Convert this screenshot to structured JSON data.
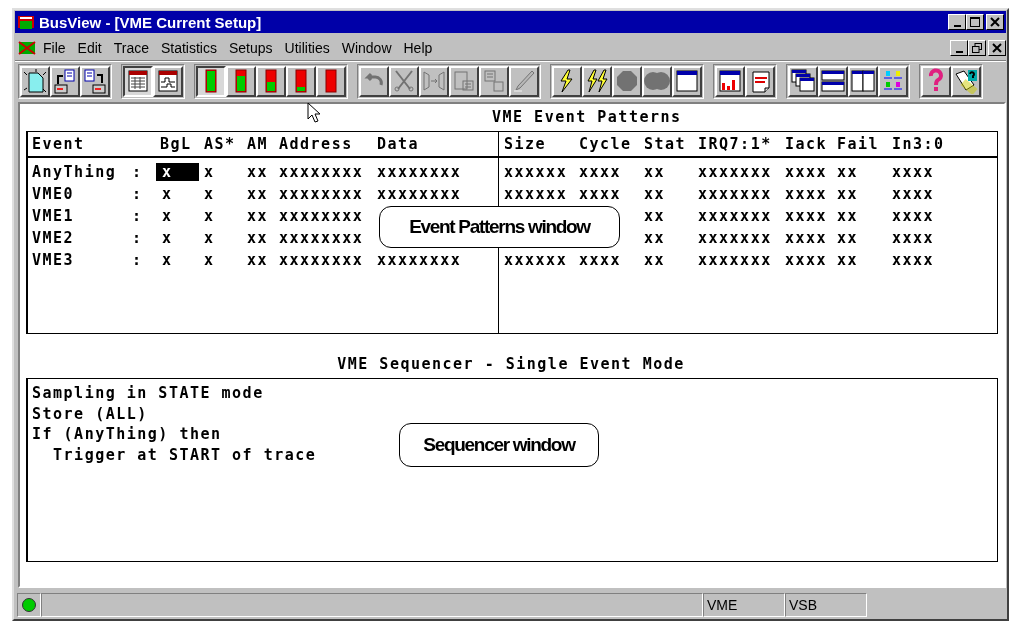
{
  "window": {
    "title": "BusView - [VME Current Setup]"
  },
  "menu": [
    "File",
    "Edit",
    "Trace",
    "Statistics",
    "Setups",
    "Utilities",
    "Window",
    "Help"
  ],
  "toolbar": [
    [
      {
        "kind": "new",
        "disabled": false,
        "pressed": false
      },
      {
        "kind": "open",
        "disabled": false,
        "pressed": false
      },
      {
        "kind": "save",
        "disabled": false,
        "pressed": false
      }
    ],
    [
      {
        "kind": "table",
        "disabled": false,
        "pressed": true
      },
      {
        "kind": "waveform",
        "disabled": false,
        "pressed": false
      }
    ],
    [
      {
        "kind": "all-green",
        "disabled": false,
        "pressed": true
      },
      {
        "kind": "mostly-green",
        "disabled": false,
        "pressed": false
      },
      {
        "kind": "half-green",
        "disabled": false,
        "pressed": false
      },
      {
        "kind": "mostly-red",
        "disabled": false,
        "pressed": false
      },
      {
        "kind": "all-red",
        "disabled": false,
        "pressed": false
      }
    ],
    [
      {
        "kind": "undo",
        "disabled": true,
        "pressed": false
      },
      {
        "kind": "cut",
        "disabled": true,
        "pressed": false
      },
      {
        "kind": "split",
        "disabled": true,
        "pressed": false
      },
      {
        "kind": "paste",
        "disabled": true,
        "pressed": false
      },
      {
        "kind": "paste-table",
        "disabled": true,
        "pressed": false
      },
      {
        "kind": "pen",
        "disabled": true,
        "pressed": false
      }
    ],
    [
      {
        "kind": "bolt",
        "disabled": false,
        "pressed": false
      },
      {
        "kind": "bolts",
        "disabled": false,
        "pressed": false
      },
      {
        "kind": "stop",
        "disabled": true,
        "pressed": false
      },
      {
        "kind": "stops",
        "disabled": true,
        "pressed": false
      },
      {
        "kind": "window",
        "disabled": false,
        "pressed": false
      }
    ],
    [
      {
        "kind": "chart",
        "disabled": false,
        "pressed": false
      },
      {
        "kind": "trap",
        "disabled": false,
        "pressed": false
      }
    ],
    [
      {
        "kind": "cascade",
        "disabled": false,
        "pressed": false
      },
      {
        "kind": "tile-h",
        "disabled": false,
        "pressed": false
      },
      {
        "kind": "tile-v",
        "disabled": false,
        "pressed": false
      },
      {
        "kind": "arrange",
        "disabled": false,
        "pressed": false
      }
    ],
    [
      {
        "kind": "help",
        "disabled": false,
        "pressed": false
      },
      {
        "kind": "context-help",
        "disabled": false,
        "pressed": false
      }
    ]
  ],
  "patterns": {
    "title": "VME Event Patterns",
    "left_columns": [
      "Event",
      "BgL",
      "AS*",
      "AM",
      "Address",
      "Data"
    ],
    "right_columns": [
      "Size",
      "Cycle",
      "Stat",
      "IRQ7:1*",
      "Iack",
      "Fail",
      "In3:0"
    ],
    "rows": [
      {
        "event": "AnyThing",
        "sep": ":",
        "cells": [
          {
            "t": "x",
            "selected": true
          },
          {
            "t": "x",
            "selected": false
          },
          {
            "t": "xx",
            "selected": false
          },
          {
            "t": "xxxxxxxx",
            "selected": false
          },
          {
            "t": "xxxxxxxx",
            "selected": false
          },
          {
            "t": "xxxxxx",
            "selected": false
          },
          {
            "t": "xxxx",
            "selected": false
          },
          {
            "t": "xx",
            "selected": false
          },
          {
            "t": "xxxxxxx",
            "selected": false
          },
          {
            "t": "xxxx",
            "selected": false
          },
          {
            "t": "xx",
            "selected": false
          },
          {
            "t": "xxxx",
            "selected": false
          }
        ]
      },
      {
        "event": "VME0",
        "sep": ":",
        "cells": [
          {
            "t": "x",
            "selected": false
          },
          {
            "t": "x",
            "selected": false
          },
          {
            "t": "xx",
            "selected": false
          },
          {
            "t": "xxxxxxxx",
            "selected": false
          },
          {
            "t": "xxxxxxxx",
            "selected": false
          },
          {
            "t": "xxxxxx",
            "selected": false
          },
          {
            "t": "xxxx",
            "selected": false
          },
          {
            "t": "xx",
            "selected": false
          },
          {
            "t": "xxxxxxx",
            "selected": false
          },
          {
            "t": "xxxx",
            "selected": false
          },
          {
            "t": "xx",
            "selected": false
          },
          {
            "t": "xxxx",
            "selected": false
          }
        ]
      },
      {
        "event": "VME1",
        "sep": ":",
        "cells": [
          {
            "t": "x",
            "selected": false
          },
          {
            "t": "x",
            "selected": false
          },
          {
            "t": "xx",
            "selected": false
          },
          {
            "t": "xxxxxxxx",
            "selected": false
          },
          null,
          null,
          null,
          {
            "t": "xx",
            "selected": false
          },
          {
            "t": "xxxxxxx",
            "selected": false
          },
          {
            "t": "xxxx",
            "selected": false
          },
          {
            "t": "xx",
            "selected": false
          },
          {
            "t": "xxxx",
            "selected": false
          }
        ]
      },
      {
        "event": "VME2",
        "sep": ":",
        "cells": [
          {
            "t": "x",
            "selected": false
          },
          {
            "t": "x",
            "selected": false
          },
          {
            "t": "xx",
            "selected": false
          },
          {
            "t": "xxxxxxxx",
            "selected": false
          },
          null,
          null,
          null,
          {
            "t": "xx",
            "selected": false
          },
          {
            "t": "xxxxxxx",
            "selected": false
          },
          {
            "t": "xxxx",
            "selected": false
          },
          {
            "t": "xx",
            "selected": false
          },
          {
            "t": "xxxx",
            "selected": false
          }
        ]
      },
      {
        "event": "VME3",
        "sep": ":",
        "cells": [
          {
            "t": "x",
            "selected": false
          },
          {
            "t": "x",
            "selected": false
          },
          {
            "t": "xx",
            "selected": false
          },
          {
            "t": "xxxxxxxx",
            "selected": false
          },
          {
            "t": "xxxxxxxx",
            "selected": false
          },
          {
            "t": "xxxxxx",
            "selected": false
          },
          {
            "t": "xxxx",
            "selected": false
          },
          {
            "t": "xx",
            "selected": false
          },
          {
            "t": "xxxxxxx",
            "selected": false
          },
          {
            "t": "xxxx",
            "selected": false
          },
          {
            "t": "xx",
            "selected": false
          },
          {
            "t": "xxxx",
            "selected": false
          }
        ]
      }
    ]
  },
  "sequencer": {
    "title": "VME Sequencer - Single Event Mode",
    "lines": [
      "Sampling in STATE mode",
      "Store (ALL)",
      "If (AnyThing) then",
      "  Trigger at START of trace"
    ]
  },
  "callouts": [
    {
      "text": "Event Patterns window"
    },
    {
      "text": "Sequencer window"
    }
  ],
  "status_bar": {
    "led_on": true,
    "panels": [
      "VME",
      "VSB"
    ]
  }
}
